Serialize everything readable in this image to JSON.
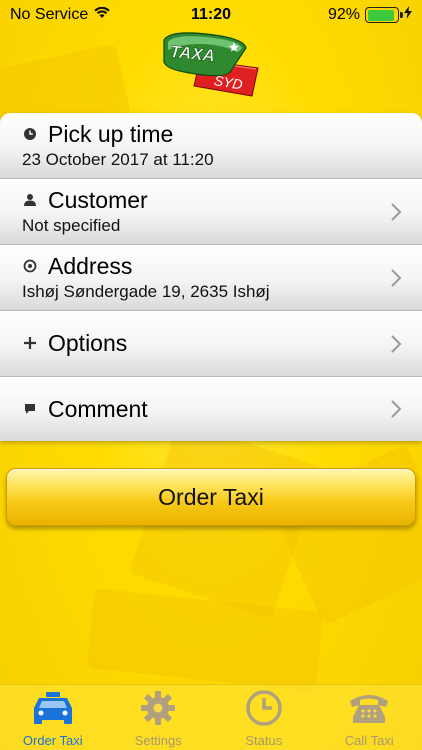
{
  "status_bar": {
    "carrier": "No Service",
    "time": "11:20",
    "battery": "92%",
    "battery_level": 0.92
  },
  "logo": {
    "text_top": "TAXA",
    "text_bottom": "SYD"
  },
  "rows": [
    {
      "title": "Pick up time",
      "subtitle": "23 October 2017 at 11:20",
      "icon": "clock-icon"
    },
    {
      "title": "Customer",
      "subtitle": "Not specified",
      "icon": "person-icon"
    },
    {
      "title": "Address",
      "subtitle": "Ishøj Søndergade 19, 2635 Ishøj",
      "icon": "location-icon"
    },
    {
      "title": "Options",
      "subtitle": "",
      "icon": "plus-icon"
    },
    {
      "title": "Comment",
      "subtitle": "",
      "icon": "comment-icon"
    }
  ],
  "order_button": {
    "label": "Order Taxi"
  },
  "tabs": [
    {
      "label": "Order Taxi",
      "icon": "taxi-icon",
      "active": true
    },
    {
      "label": "Settings",
      "icon": "gear-icon",
      "active": false
    },
    {
      "label": "Status",
      "icon": "clock-icon",
      "active": false
    },
    {
      "label": "Call Taxi",
      "icon": "phone-icon",
      "active": false
    }
  ],
  "colors": {
    "background": "#ffdc00",
    "active_tab": "#1a73d9",
    "inactive_tab": "#a89870"
  }
}
